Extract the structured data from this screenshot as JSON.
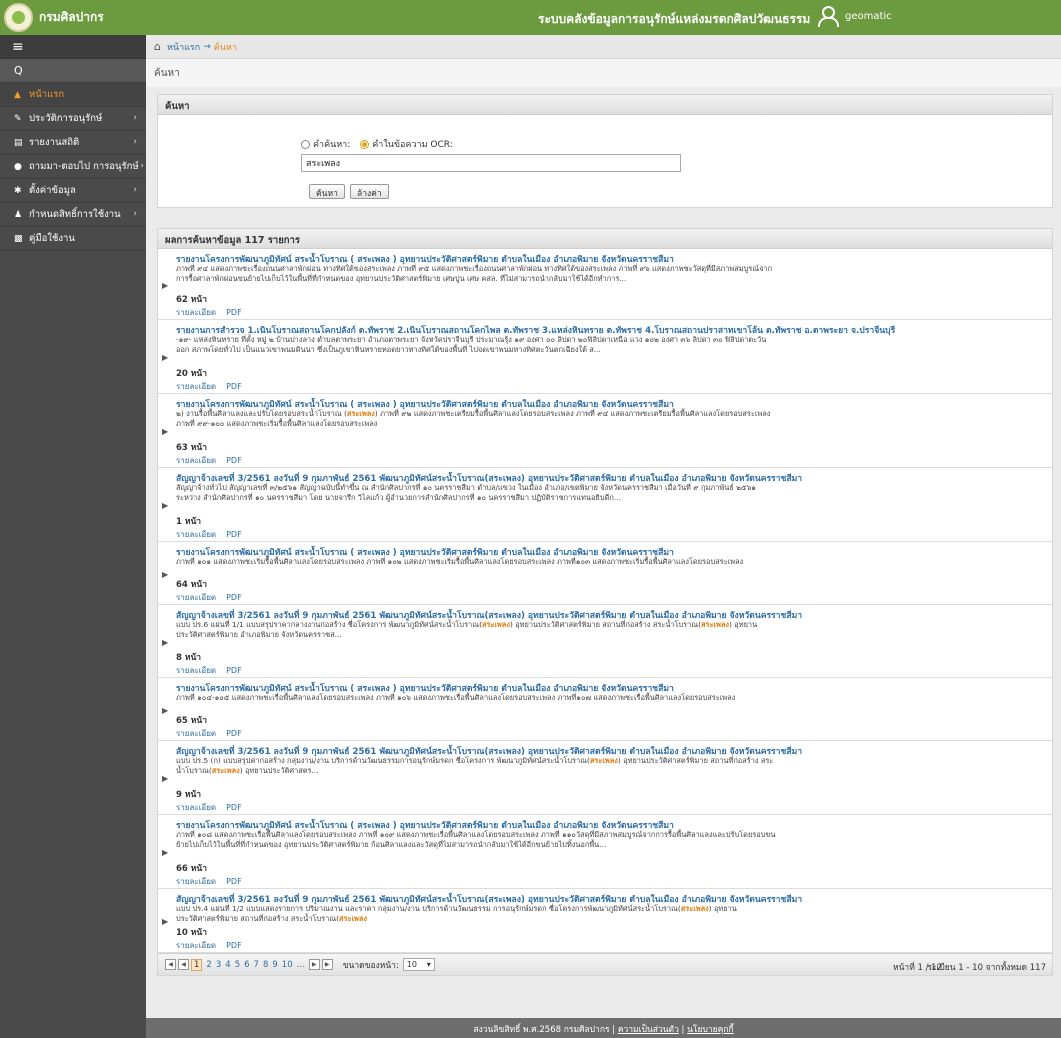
{
  "header": {
    "brand": "กรมศิลปากร",
    "system_name": "ระบบคลังข้อมูลการอนุรักษ์แหล่งมรดกศิลปวัฒนธรรม",
    "user": "geomatic",
    "color": "#6b9a3f"
  },
  "sidebar": {
    "toggle_icon": "≡",
    "search_icon": "Q",
    "items": [
      {
        "label": "หน้าแรก",
        "icon": "home-icon",
        "active": true
      },
      {
        "label": "ประวัติการอนุรักษ์",
        "icon": "edit-icon"
      },
      {
        "label": "รายงานสถิติ",
        "icon": "chart-icon"
      },
      {
        "label": "ถามมา-ตอบไป การอนุรักษ์",
        "icon": "comment-icon"
      },
      {
        "label": "ตั้งค่าข้อมูล",
        "icon": "gear-icon"
      },
      {
        "label": "กำหนดสิทธิ์การใช้งาน",
        "icon": "user-icon"
      },
      {
        "label": "คู่มือใช้งาน",
        "icon": "book-icon"
      }
    ]
  },
  "breadcrumb": {
    "home": "หน้าแรก",
    "sep": "→",
    "current": "ค้นหา"
  },
  "page_title": "ค้นหา",
  "search": {
    "panel_title": "ค้นหา",
    "option_keyword": "คำค้นหา:",
    "option_ocr": "คำในข้อความ OCR:",
    "value": "สระเพลง",
    "search_button": "ค้นหา",
    "clear_button": "ล้างค่า"
  },
  "results": {
    "title": "ผลการค้นหาข้อมูล 117 รายการ",
    "links": {
      "detail": "รายละเอียด",
      "pdf": "PDF"
    },
    "items": [
      {
        "title": "รายงานโครงการพัฒนาภูมิทัศน์ สระน้ำโบราณ ( สระเพลง ) อุทยานประวัติศาสตร์พิมาย ตำบลในเมือง อำเภอพิมาย จังหวัดนครราชสีมา",
        "snippet": [
          "ภาพที่ ๙๔ แสดงภาพชะเรื่องถนนศาลาพักผ่อน ทางทิศใต้ของสระเพลง ภาพที่ ๙๕ แสดงภาพชะเรื่องถนนศาลาพักผ่อน ทางทิศใต้ของ",
          "สระเพลง ภาพที่ ๙๖ แสดงภาพชะวัสดุที่มีสภาพสมบูรณ์จากการรื้อศาลาพักผ่อนขนย้ายไปเก็บไว้ในพื้นที่ที่กำหนดของ อุทยาน",
          "ประวัติศาสตร์พิมาย เศษปูน เศษ คสล. ที่ไม่สามารถนำกลับมาใช้ได้อีกทำการ..."
        ],
        "pages": "62 หน้า"
      },
      {
        "title": "รายงานการสำรวจ 1.เนินโบราณสถานโคกปลังก์ ต.ทัพราช 2.เนินโบราณสถานโคกไพล ต.ทัพราช 3.แหล่งหินทราย ต.ทัพราช 4.โบราณสถานปราสาทเขาโล้น ต.ทัพราช อ.ตาพระยา จ.ปราจีนบุรี",
        "snippet": [
          "-๑๙- แหล่งหินทราย ที่ตั้ง หมู่ ๒ บ้านปางลาง ตำบลตาพระยา อำเภอตาพระยา จังหวัดปราจีนบุรี ประมาณรุ้ง ๑๙ องศา ๐๐ ลิปดา ๒๐",
          "ฟิลิปดาเหนือ แวง ๑๐๒ องศา ๓๖ ลิปดา ๓๐ ฟิลิปดาตะวันออก สภาพโดยทั่วไป เป็นแนวเขาพนมดินนา ซึ่งเป็นภูเขาหินทรายทอดยาว",
          "ทางทิศใต้ของพื้นที่ ไปจดเขาพนมทางทิศตะวันตกเฉียงใต้ ส..."
        ],
        "pages": "20 หน้า"
      },
      {
        "title": "รายงานโครงการพัฒนาภูมิทัศน์ สระน้ำโบราณ ( สระเพลง ) อุทยานประวัติศาสตร์พิมาย ตำบลในเมือง อำเภอพิมาย จังหวัดนครราชสีมา",
        "snippet": [
          "๒) งานรื้อพื้นศิลาแลงและปรับโดยรอบสระน้ำโบราณ (",
          "HL:สระเพลง",
          ") ภาพที่ ๙๒ แสดงภาพชะเตรียมรื้อพื้นศิลาแลงโดยรอบสระ",
          "เพลง ภาพที่ ๙๔ แสดงภาพชะเตรียมรื้อพื้นศิลาแลงโดยรอบสระเพลง ภาพที่ ๙๙-๑๐๐ แสดงภาพชะเริ่มรื้อพื้นศิลาแลงโดยรอบสระ",
          "เพลง"
        ],
        "pages": "63 หน้า"
      },
      {
        "title": "สัญญาจ้างเลขที่ 3/2561 ลงวันที่ 9 กุมภาพันธ์ 2561 พัฒนาภูมิทัศน์สระน้ำโบราณ(สระเพลง) อุทยานประวัติศาสตร์พิมาย ตำบลในเมือง อำเภอพิมาย จังหวัดนครราชสีมา",
        "snippet": [
          "สัญญาจ้างทั่วไป สัญญาเลขที่ ๓/๒๕๖๑ สัญญาฉบับนี้ทำขึ้น ณ สำนักศิลปากรที่ ๑๐ นครราชสีมา ตำบล/แขวง ในเมือง อำเภอ/เขต",
          "พิมาย จังหวัดนครราชสีมา เมื่อวันที่ ๙ กุมภาพันธ์ ๒๕๖๑ ระหว่าง สำนักศิลปากรที่ ๑๐ นครราชสีมา โดย นายจารึก วิไลแก้ว ผู้อำนวย",
          "การสำนักศิลปากรที่ ๑๐ นครราชสีมา ปฏิบัติราชการแทนอธิบดีก..."
        ],
        "pages": "1 หน้า"
      },
      {
        "title": "รายงานโครงการพัฒนาภูมิทัศน์ สระน้ำโบราณ ( สระเพลง ) อุทยานประวัติศาสตร์พิมาย ตำบลในเมือง อำเภอพิมาย จังหวัดนครราชสีมา",
        "snippet": [
          "ภาพที่ ๑๐๑ แสดงภาพชะเริ่มรื้อพื้นศิลาแลงโดยรอบสระเพลง ภาพที่ ๑๐๒ แสดงภาพชะเริ่มรื้อพื้นศิลาแลงโดยรอบสระเพลง ภาพที่",
          "๑๐๓ แสดงภาพชะเริ่มรื้อพื้นศิลาแลงโดยรอบสระเพลง"
        ],
        "pages": "64 หน้า"
      },
      {
        "title": "สัญญาจ้างเลขที่ 3/2561 ลงวันที่ 9 กุมภาพันธ์ 2561 พัฒนาภูมิทัศน์สระน้ำโบราณ(สระเพลง) อุทยานประวัติศาสตร์พิมาย ตำบลในเมือง อำเภอพิมาย จังหวัดนครราชสีมา",
        "snippet": [
          "แบบ ปร.6 แผ่นที่ 1/1 แบบสรุปราคากลางงานก่อสร้าง ชื่อโครงการ พัฒนาภูมิทัศน์สระน้ำโบราณ(",
          "HL:สระเพลง",
          ") อุทยานประวัติศาสตร์",
          "พิมาย สถานที่ก่อสร้าง สระน้ำโบราณ(",
          "HL:สระเพลง",
          ") อุทยานประวัติศาสตร์พิมาย อำเภอพิมาย จังหวัดนครราชส..."
        ],
        "pages": "8 หน้า"
      },
      {
        "title": "รายงานโครงการพัฒนาภูมิทัศน์ สระน้ำโบราณ ( สระเพลง ) อุทยานประวัติศาสตร์พิมาย ตำบลในเมือง อำเภอพิมาย จังหวัดนครราชสีมา",
        "snippet": [
          "ภาพที่ ๑๐๔-๑๐๕ แสดงภาพชะเรื่อพื้นศิลาแลงโดยรอบสระเพลง ภาพที่ ๑๐๖ แสดงภาพชะเรื่อพื้นศิลาแลงโดยรอบสระเพลง ภาพที่",
          "๑๐๗ แสดงภาพชะเรื่อพื้นศิลาแลงโดยรอบสระเพลง"
        ],
        "pages": "65 หน้า"
      },
      {
        "title": "สัญญาจ้างเลขที่ 3/2561 ลงวันที่ 9 กุมภาพันธ์ 2561 พัฒนาภูมิทัศน์สระน้ำโบราณ(สระเพลง) อุทยานประวัติศาสตร์พิมาย ตำบลในเมือง อำเภอพิมาย จังหวัดนครราชสีมา",
        "snippet": [
          "แบบ ปร.5 (ก) แบบสรุปค่าก่อสร้าง กลุ่มงาน/งาน บริการด้านวัฒนธรรมการอนุรักษ์มรดก ชื่อโครงการ พัฒนาภูมิทัศน์สระน้ำโบราณ(",
          "HL:สระ",
          "",
          "HL:เพลง",
          ") อุทยานประวัติศาสตร์พิมาย สถานที่ก่อสร้าง สระน้ำโบราณ(",
          "HL:สระเพลง",
          ") อุทยานประวัติศาสตร..."
        ],
        "pages": "9 หน้า"
      },
      {
        "title": "รายงานโครงการพัฒนาภูมิทัศน์ สระน้ำโบราณ ( สระเพลง ) อุทยานประวัติศาสตร์พิมาย ตำบลในเมือง อำเภอพิมาย จังหวัดนครราชสีมา",
        "snippet": [
          "ภาพที่ ๑๐๘ แสดงภาพชะเรื่อพื้นศิลาแลงโดยรอบสระเพลง ภาพที่ ๑๐๙ แสดงภาพชะเรื่อพื้นศิลาแลงโดยรอบสระเพลง ภาพที่ ๑๑๐",
          "วัสดุที่มีสภาพสมบูรณ์จากการรื้อพื้นศิลาแลงและปรับโดยรอบขนย้ายไปเก็บไว้ในพื้นที่ที่กำหนดของ อุทยานประวัติศาสตร์พิมาย ก้อนศิลา",
          "แลงและวัสดุที่ไม่สามารถนำกลับมาใช้ได้อีกขนย้ายไปทิ้งนอกพื้น..."
        ],
        "pages": "66 หน้า"
      },
      {
        "title": "สัญญาจ้างเลขที่ 3/2561 ลงวันที่ 9 กุมภาพันธ์ 2561 พัฒนาภูมิทัศน์สระน้ำโบราณ(สระเพลง) อุทยานประวัติศาสตร์พิมาย ตำบลในเมือง อำเภอพิมาย จังหวัดนครราชสีมา",
        "snippet": [
          "แบบ ปร.4 แผ่นที่ 1/2 แบบแสดงรายการ ปริมาณงาน และราคา กลุ่มงาน/งาน บริการด้านวัฒนธรรม การอนุรักษ์มรดก ชื่อโครงการ",
          "พัฒนาภูมิทัศน์สระน้ำโบราณ(",
          "HL:สระเพลง",
          ") อุทยานประวัติศาสตร์พิมาย สถานที่ก่อสร้าง สระน้ำโบราณ(",
          "HL:สระเพลง"
        ],
        "pages": "10 หน้า"
      }
    ]
  },
  "pager": {
    "pages": [
      "1",
      "2",
      "3",
      "4",
      "5",
      "6",
      "7",
      "8",
      "9",
      "10",
      "..."
    ],
    "current": "1",
    "page_size_label": "ขนาดของหน้า:",
    "page_size": "10",
    "page_info": "หน้าที่ 1 / 12",
    "record_info": "ระเบียน 1 - 10 จากทั้งหมด 117"
  },
  "footer": {
    "copyright": "สงวนลิขสิทธิ์ พ.ศ.2568 กรมศิลปากร",
    "sep": "|",
    "privacy": "ความเป็นส่วนตัว",
    "policy": "นโยบายคุกกี้"
  }
}
